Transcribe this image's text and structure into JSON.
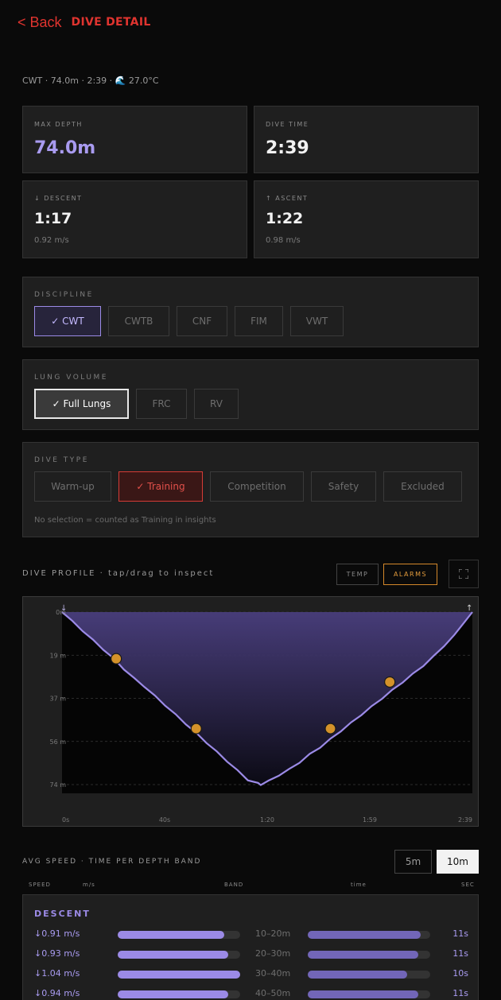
{
  "header": {
    "back_label": "< Back",
    "title": "DIVE DETAIL"
  },
  "summary": "CWT · 74.0m · 2:39 · 🌊 27.0°C",
  "stats": {
    "max_depth": {
      "label": "MAX DEPTH",
      "value": "74.0m"
    },
    "dive_time": {
      "label": "DIVE TIME",
      "value": "2:39"
    },
    "descent": {
      "label": "↓ DESCENT",
      "value": "1:17",
      "speed": "0.92 m/s"
    },
    "ascent": {
      "label": "↑ ASCENT",
      "value": "1:22",
      "speed": "0.98 m/s"
    }
  },
  "discipline": {
    "label": "DISCIPLINE",
    "options": [
      "✓ CWT",
      "CWTB",
      "CNF",
      "FIM",
      "VWT"
    ],
    "selected": 0
  },
  "lung_volume": {
    "label": "LUNG VOLUME",
    "options": [
      "✓ Full Lungs",
      "FRC",
      "RV"
    ],
    "selected": 0
  },
  "dive_type": {
    "label": "DIVE TYPE",
    "options": [
      "Warm-up",
      "✓ Training",
      "Competition",
      "Safety",
      "Excluded"
    ],
    "selected": 1,
    "note": "No selection = counted as Training in insights"
  },
  "profile": {
    "title": "DIVE PROFILE · tap/drag to inspect",
    "temp_label": "TEMP",
    "alarms_label": "ALARMS"
  },
  "chart_data": {
    "type": "area",
    "y_ticks": [
      "0m",
      "19 m",
      "37 m",
      "56 m",
      "74 m"
    ],
    "x_ticks": [
      "0s",
      "40s",
      "1:20",
      "1:59",
      "2:39"
    ],
    "ylim": [
      0,
      74
    ],
    "xlim": [
      0,
      159
    ],
    "inverted_y": true,
    "series": [
      {
        "x": [
          0,
          4,
          8,
          12,
          16,
          20,
          24,
          28,
          32,
          36,
          40,
          44,
          48,
          52,
          56,
          60,
          64,
          68,
          72,
          76,
          77,
          80,
          84,
          88,
          92,
          96,
          100,
          104,
          108,
          112,
          116,
          120,
          124,
          128,
          132,
          136,
          140,
          144,
          148,
          152,
          156,
          159
        ],
        "y": [
          0,
          4,
          8,
          12,
          16,
          20,
          24.5,
          28.5,
          32,
          36,
          40,
          44,
          48,
          52,
          56,
          60,
          64,
          68,
          72,
          73.5,
          74,
          72.5,
          70,
          67.5,
          64.5,
          61,
          58,
          54.5,
          51,
          47.5,
          44,
          40.5,
          37,
          33.5,
          30,
          26.5,
          23,
          19,
          14.5,
          10,
          4,
          0
        ]
      }
    ],
    "alarms": [
      {
        "x": 21,
        "y": 20
      },
      {
        "x": 52,
        "y": 50
      },
      {
        "x": 104,
        "y": 50
      },
      {
        "x": 127,
        "y": 30
      }
    ],
    "colors": {
      "line": "#9b8ae6",
      "alarm": "#d4922a"
    }
  },
  "speed": {
    "title": "AVG SPEED · TIME PER DEPTH BAND",
    "toggle_5m": "5m",
    "toggle_10m": "10m",
    "columns": [
      "SPEED",
      "m/s",
      "BAND",
      "time",
      "SEC"
    ],
    "section_label": "DESCENT",
    "rows": [
      {
        "speed": "↓0.91 m/s",
        "speed_frac": 0.87,
        "band": "10–20m",
        "time_frac": 0.92,
        "sec": "11s"
      },
      {
        "speed": "↓0.93 m/s",
        "speed_frac": 0.9,
        "band": "20–30m",
        "time_frac": 0.9,
        "sec": "11s"
      },
      {
        "speed": "↓1.04 m/s",
        "speed_frac": 1.0,
        "band": "30–40m",
        "time_frac": 0.81,
        "sec": "10s"
      },
      {
        "speed": "↓0.94 m/s",
        "speed_frac": 0.9,
        "band": "40–50m",
        "time_frac": 0.9,
        "sec": "11s"
      }
    ]
  }
}
